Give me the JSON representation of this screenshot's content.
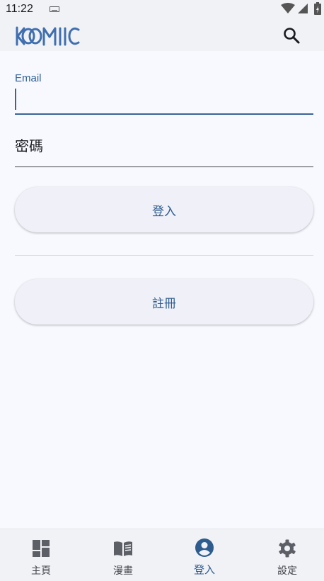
{
  "status_bar": {
    "time": "11:22"
  },
  "app_bar": {
    "logo_text": "KOMIIC"
  },
  "form": {
    "email_label": "Email",
    "email_value": "",
    "password_label": "密碼",
    "login_label": "登入",
    "register_label": "註冊"
  },
  "bottom_nav": {
    "items": [
      {
        "label": "主頁",
        "icon": "dashboard-icon"
      },
      {
        "label": "漫畫",
        "icon": "book-icon"
      },
      {
        "label": "登入",
        "icon": "account-circle-icon"
      },
      {
        "label": "設定",
        "icon": "gear-icon"
      }
    ],
    "active_index": 2
  },
  "colors": {
    "primary": "#2e5c8f",
    "background": "#f8f9ff",
    "surface": "#f1f2f6",
    "icon_inactive": "#5c5f66"
  }
}
